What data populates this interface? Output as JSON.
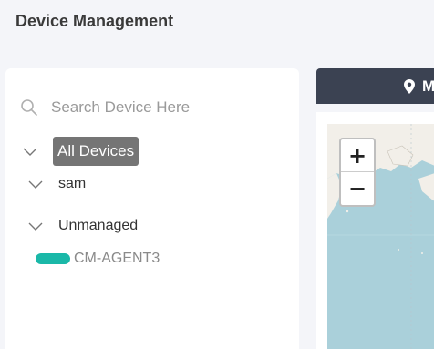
{
  "page": {
    "title": "Device Management"
  },
  "search": {
    "placeholder": "Search Device Here",
    "icon": "search-icon"
  },
  "tree": {
    "root": {
      "label": "All Devices",
      "selected": true
    },
    "groups": [
      {
        "label": "sam"
      },
      {
        "label": "Unmanaged",
        "devices": [
          {
            "label": "CM-AGENT3",
            "status_color": "#1ab8a8"
          }
        ]
      }
    ]
  },
  "map": {
    "tab_label": "M",
    "tab_icon": "map-pin-icon",
    "zoom_in": "+",
    "zoom_out": "−",
    "water_color": "#aad0da",
    "land_color": "#f2efe9"
  },
  "colors": {
    "tab_background": "#3b4252",
    "selected_node_background": "#757575",
    "page_background": "#f4f5f9"
  }
}
